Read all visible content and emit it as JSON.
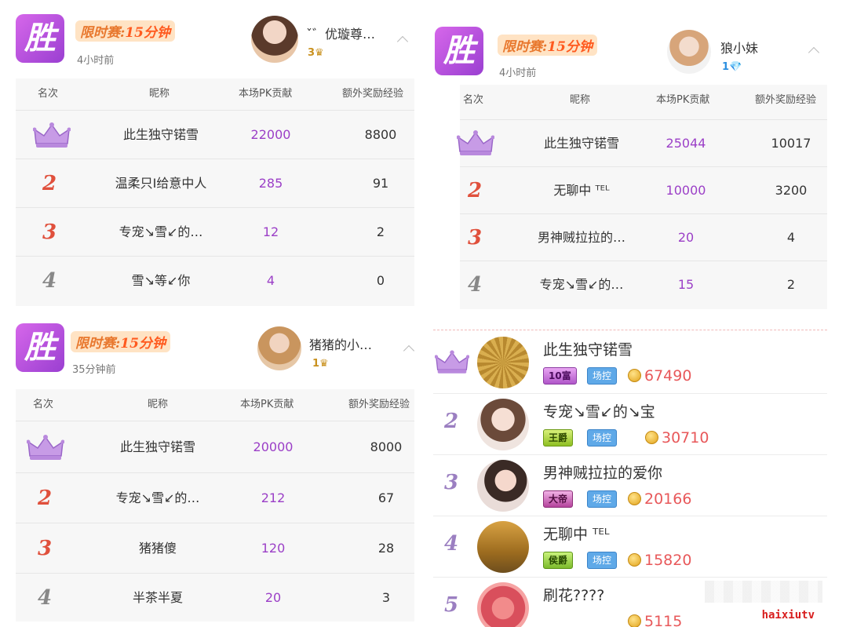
{
  "panels": [
    {
      "win_label": "胜",
      "race_label": "限时赛",
      "race_minutes": "15分钟",
      "time": "4小时前",
      "nickname": "ˇ゛优璇尊…",
      "level": "3",
      "level_icon": "crown-icon",
      "headers": [
        "名次",
        "昵称",
        "本场PK贡献",
        "额外奖励经验"
      ],
      "rows": [
        {
          "rank": "crown",
          "name": "此生独守锘雪",
          "pk": "22000",
          "exp": "8800"
        },
        {
          "rank": "2",
          "name": "温柔只I给意中人",
          "pk": "285",
          "exp": "91"
        },
        {
          "rank": "3",
          "name": "专宠↘雪↙的…",
          "pk": "12",
          "exp": "2"
        },
        {
          "rank": "4",
          "name": "雪↘等↙你",
          "pk": "4",
          "exp": "0"
        }
      ]
    },
    {
      "win_label": "胜",
      "race_label": "限时赛",
      "race_minutes": "15分钟",
      "time": "4小时前",
      "nickname": "狼小妹",
      "level": "1",
      "level_icon": "diamond-icon",
      "headers": [
        "名次",
        "昵称",
        "本场PK贡献",
        "额外奖励经验"
      ],
      "rows": [
        {
          "rank": "crown",
          "name": "此生独守锘雪",
          "pk": "25044",
          "exp": "10017"
        },
        {
          "rank": "2",
          "name": "无聊中 ᵀᴱᴸ",
          "pk": "10000",
          "exp": "3200"
        },
        {
          "rank": "3",
          "name": "男神贼拉拉的…",
          "pk": "20",
          "exp": "4"
        },
        {
          "rank": "4",
          "name": "专宠↘雪↙的…",
          "pk": "15",
          "exp": "2"
        }
      ]
    },
    {
      "win_label": "胜",
      "race_label": "限时赛",
      "race_minutes": "15分钟",
      "time": "35分钟前",
      "nickname": "猪猪的小…",
      "level": "1",
      "level_icon": "crown-icon",
      "headers": [
        "名次",
        "昵称",
        "本场PK贡献",
        "额外奖励经验"
      ],
      "rows": [
        {
          "rank": "crown",
          "name": "此生独守锘雪",
          "pk": "20000",
          "exp": "8000"
        },
        {
          "rank": "2",
          "name": "专宠↘雪↙的…",
          "pk": "212",
          "exp": "67"
        },
        {
          "rank": "3",
          "name": "猪猪傻",
          "pk": "120",
          "exp": "28"
        },
        {
          "rank": "4",
          "name": "半茶半夏",
          "pk": "20",
          "exp": "3"
        }
      ]
    }
  ],
  "leaderboard": [
    {
      "rank": "crown",
      "name": "此生独守锘雪",
      "title": "10富",
      "ctrl": "场控",
      "coins": "67490"
    },
    {
      "rank": "2",
      "name": "专宠↘雪↙的↘宝",
      "title": "王爵",
      "ctrl": "场控",
      "coins": "30710"
    },
    {
      "rank": "3",
      "name": "男神贼拉拉的爱你",
      "title": "大帝",
      "ctrl": "场控",
      "coins": "20166"
    },
    {
      "rank": "4",
      "name": "无聊中 ᵀᴱᴸ",
      "title": "侯爵",
      "ctrl": "场控",
      "coins": "15820"
    },
    {
      "rank": "5",
      "name": "刷花????",
      "title": "",
      "ctrl": "",
      "coins": "5115"
    }
  ],
  "watermark": "haixiutv",
  "colors": {
    "win_purple": "#b04fe0",
    "pk_purple": "#9b3fc7",
    "rank_red": "#e0503c",
    "coin_red": "#e8585a"
  }
}
